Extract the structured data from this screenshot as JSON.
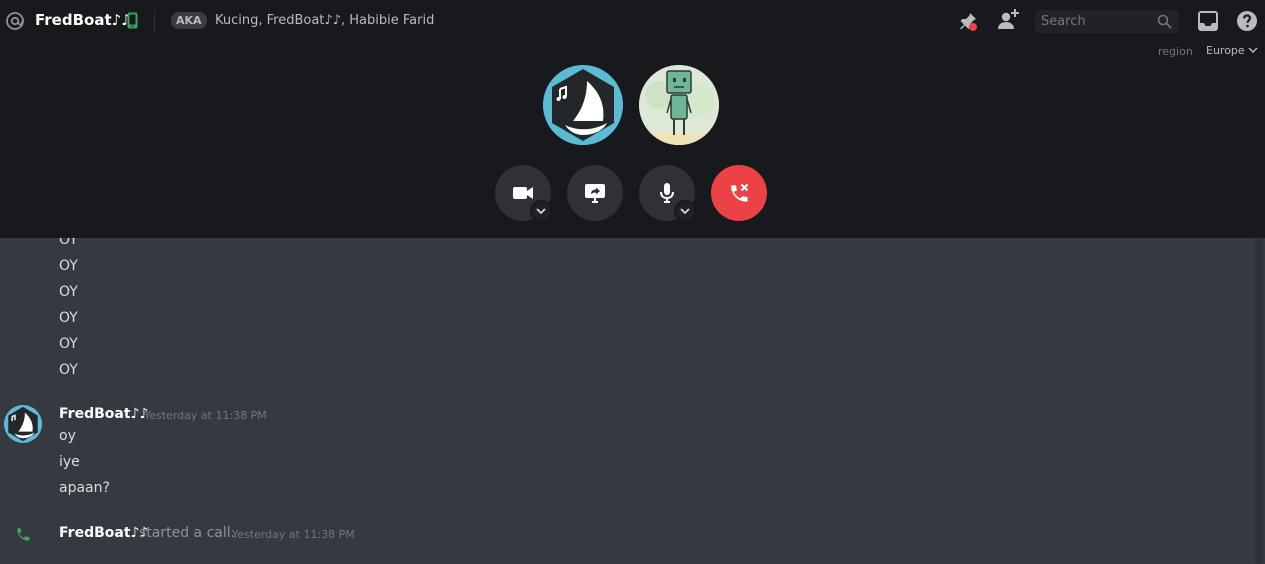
{
  "header": {
    "channel_name": "FredBoat♪♪",
    "aka_label": "AKA",
    "aka_names": "Kucing, FredBoat♪♪, Habibie Farid"
  },
  "toolbar": {
    "search_placeholder": "Search"
  },
  "region": {
    "label": "region",
    "value": "Europe"
  },
  "messages": {
    "previous_lines": [
      "OY",
      "OY",
      "OY",
      "OY",
      "OY",
      "OY"
    ],
    "group": {
      "author": "FredBoat♪♪",
      "timestamp": "Yesterday at 11:38 PM",
      "lines": [
        "oy",
        "iye",
        "apaan?"
      ]
    },
    "system": {
      "author": "FredBoat♪♪",
      "text": "started a call.",
      "timestamp": "Yesterday at 11:38 PM"
    }
  },
  "colors": {
    "call_background": "#18191c",
    "chat_background": "#36393f",
    "hangup": "#ed4245",
    "online_green": "#3ba55d",
    "notification_red": "#ed4245"
  },
  "icons": [
    "at-icon",
    "mobile-icon",
    "pin-icon",
    "add-user-icon",
    "search-icon",
    "inbox-icon",
    "help-icon",
    "video-icon",
    "screen-share-icon",
    "microphone-icon",
    "hangup-icon",
    "phone-icon"
  ]
}
